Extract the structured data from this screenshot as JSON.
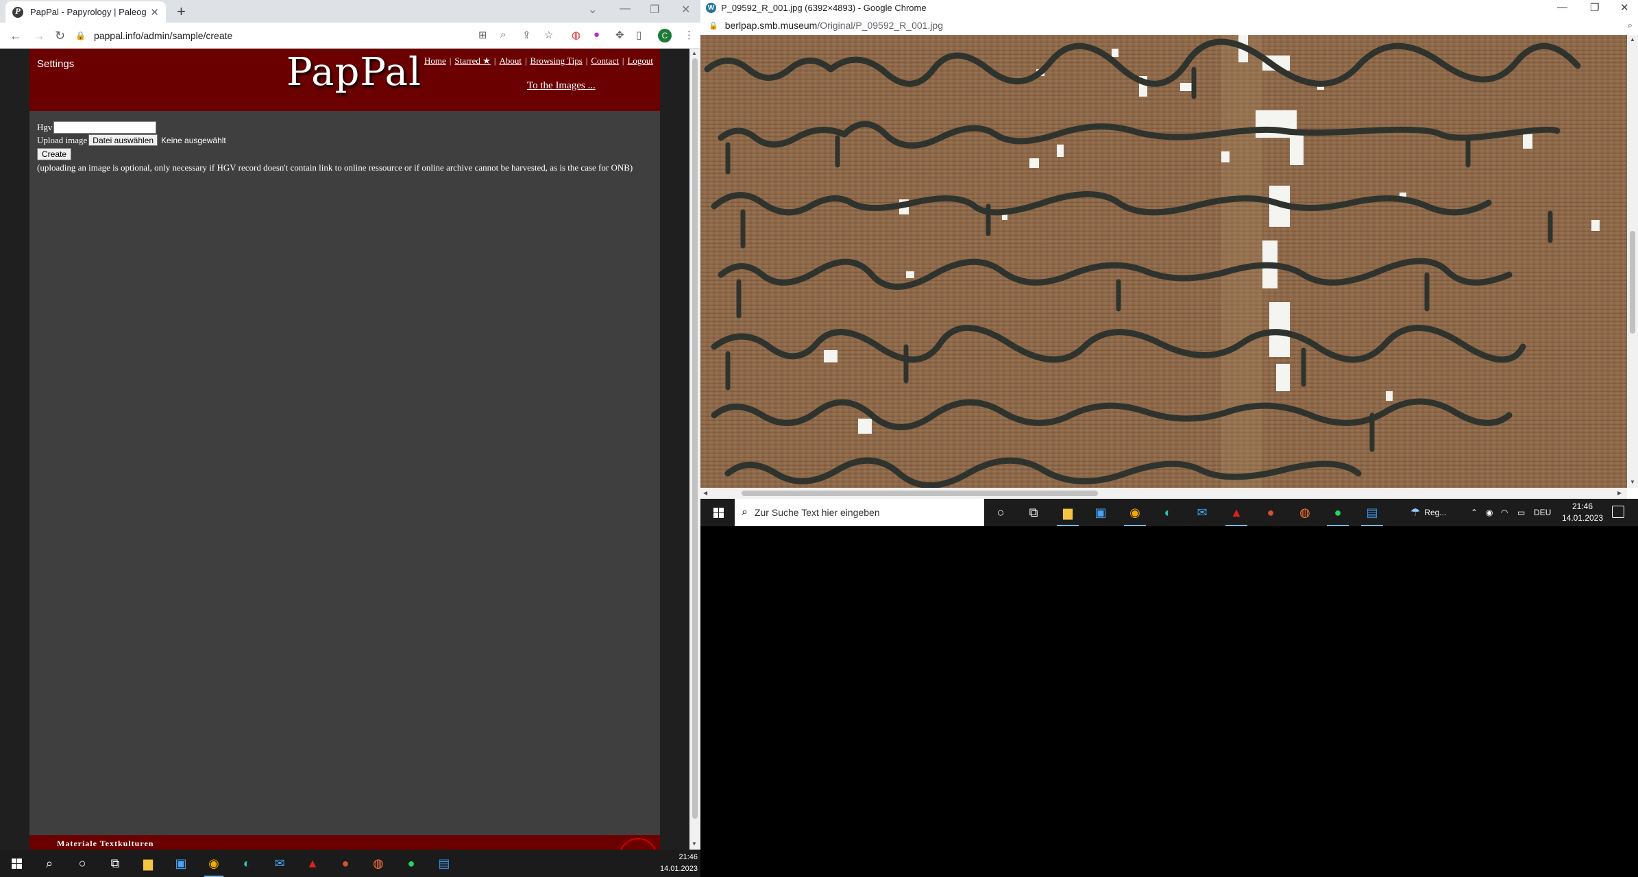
{
  "left_browser": {
    "tab": {
      "title": "PapPal - Papyrology | Paleograph",
      "close": "✕",
      "favicon": "P"
    },
    "new_tab": "+",
    "url": "pappal.info/admin/sample/create",
    "profile_initial": "C"
  },
  "site": {
    "settings": "Settings",
    "logo": "PapPal",
    "nav": [
      {
        "label": "Home"
      },
      {
        "label": "Starred ★"
      },
      {
        "label": "About"
      },
      {
        "label": "Browsing Tips"
      },
      {
        "label": "Contact"
      },
      {
        "label": "Logout"
      }
    ],
    "nav_sep": "|",
    "to_images": "To the Images ...",
    "form": {
      "hgv_label": "Hgv",
      "hgv_value": "",
      "upload_label": "Upload image",
      "file_button": "Datei auswählen",
      "no_file": "Keine ausgewählt",
      "create_button": "Create",
      "note": "(uploading an image is optional, only necessary if HGV record doesn't contain link to online ressource or if online archive cannot be harvested, as is the case for ONB)"
    },
    "footer_text": "Materiale Textkulturen"
  },
  "taskbar_left": {
    "time": "21:46",
    "date": "14.01.2023"
  },
  "right_browser": {
    "favicon": "W",
    "title": "P_09592_R_001.jpg (6392×4893) - Google Chrome",
    "url_host": "berlpap.smb.museum",
    "url_path": "/Original/P_09592_R_001.jpg"
  },
  "taskbar_right": {
    "search_placeholder": "Zur Suche Text hier eingeben",
    "weather": "Reg...",
    "language": "DEU",
    "time": "21:46",
    "date": "14.01.2023"
  },
  "colors": {
    "header_red": "#6b0000",
    "page_bg": "#3f3f3f",
    "papyrus": "#8a6546",
    "ink": "#2f332d"
  }
}
